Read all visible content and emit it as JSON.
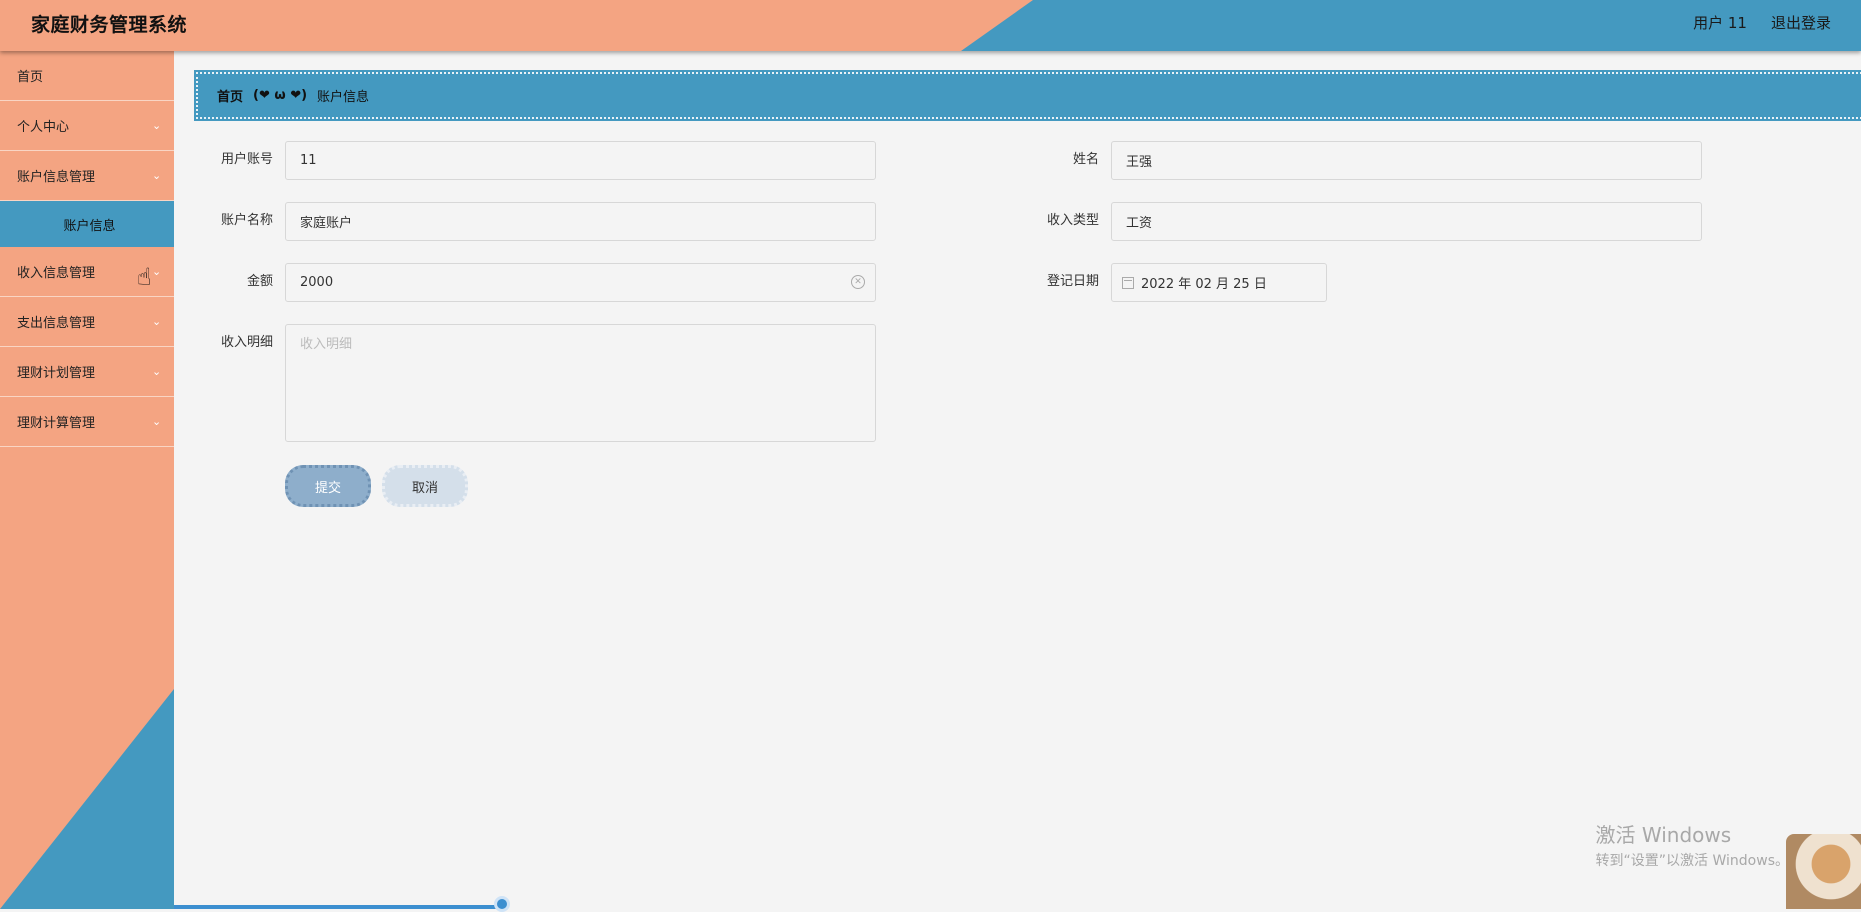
{
  "header": {
    "title": "家庭财务管理系统",
    "user_label": "用户 11",
    "logout_label": "退出登录"
  },
  "sidebar": {
    "items": [
      {
        "label": "首页",
        "has_chevron": false
      },
      {
        "label": "个人中心",
        "has_chevron": true
      },
      {
        "label": "账户信息管理",
        "has_chevron": true
      },
      {
        "label": "账户信息",
        "is_sub": true
      },
      {
        "label": "收入信息管理",
        "has_chevron": true
      },
      {
        "label": "支出信息管理",
        "has_chevron": true
      },
      {
        "label": "理财计划管理",
        "has_chevron": true
      },
      {
        "label": "理财计算管理",
        "has_chevron": true
      }
    ]
  },
  "breadcrumb": {
    "home": "首页",
    "separator": "(❤ ω ❤)",
    "current": "账户信息"
  },
  "form": {
    "account_label": "用户账号",
    "account_value": "11",
    "name_label": "姓名",
    "name_value": "王强",
    "account_name_label": "账户名称",
    "account_name_value": "家庭账户",
    "income_type_label": "收入类型",
    "income_type_value": "工资",
    "amount_label": "金额",
    "amount_value": "2000",
    "date_label": "登记日期",
    "date_value": "2022 年 02 月 25 日",
    "detail_label": "收入明细",
    "detail_placeholder": "收入明细",
    "submit_label": "提交",
    "cancel_label": "取消"
  },
  "watermark": {
    "line1": "激活 Windows",
    "line2": "转到“设置”以激活 Windows。"
  },
  "colors": {
    "accent_orange": "#f4a482",
    "accent_blue": "#4499c0",
    "submit_button": "#8eaecb",
    "cancel_button": "#d4dfea"
  }
}
